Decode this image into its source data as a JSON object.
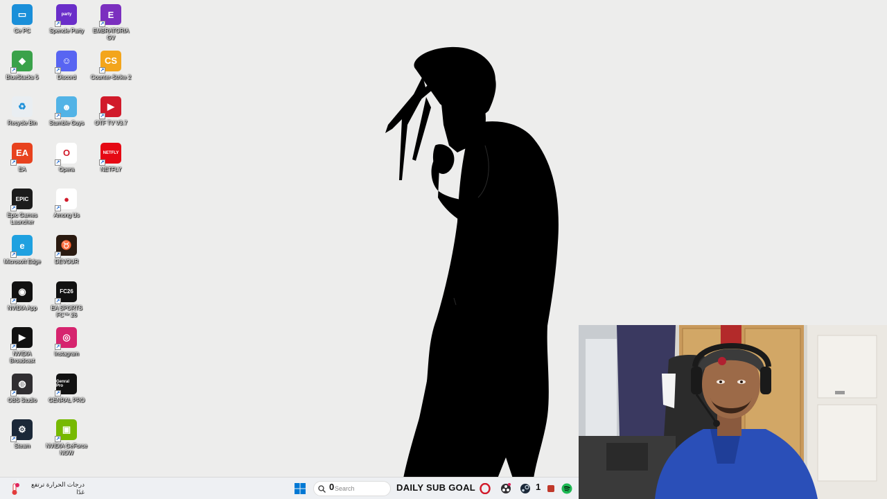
{
  "desktop": {
    "icons": [
      {
        "label": "Ce PC",
        "icon": "computer-icon",
        "color": "#1a8fd9",
        "glyph": "▭"
      },
      {
        "label": "Spencle Party",
        "icon": "spencle-party-icon",
        "color": "#6a2ec9",
        "glyph": "party"
      },
      {
        "label": "EMBRATORIA GV",
        "icon": "embratoria-icon",
        "color": "#7b2fbf",
        "glyph": "E"
      },
      {
        "label": "BlueStacks 5",
        "icon": "bluestacks-icon",
        "color": "#3aa24a",
        "glyph": "◆"
      },
      {
        "label": "Discord",
        "icon": "discord-icon",
        "color": "#5865f2",
        "glyph": "☺"
      },
      {
        "label": "Counter-Strike 2",
        "icon": "counter-strike-icon",
        "color": "#f3a51c",
        "glyph": "CS"
      },
      {
        "label": "Recycle Bin",
        "icon": "recycle-bin-icon",
        "color": "#e9eef2",
        "glyph": "♻"
      },
      {
        "label": "Stumble Guys",
        "icon": "stumble-guys-icon",
        "color": "#52b3e6",
        "glyph": "☻"
      },
      {
        "label": "OTF TV V3.7",
        "icon": "otf-tv-icon",
        "color": "#d11a2a",
        "glyph": "▶"
      },
      {
        "label": "EA",
        "icon": "ea-icon",
        "color": "#e8421e",
        "glyph": "EA"
      },
      {
        "label": "Opera",
        "icon": "opera-icon",
        "color": "#ffffff",
        "glyph": "O"
      },
      {
        "label": "NETFLY",
        "icon": "netfly-icon",
        "color": "#e50914",
        "glyph": "NETFLY"
      },
      {
        "label": "Epic Games Launcher",
        "icon": "epic-games-icon",
        "color": "#1c1c1c",
        "glyph": "EPIC"
      },
      {
        "label": "Among Us",
        "icon": "among-us-icon",
        "color": "#ffffff",
        "glyph": "●"
      },
      {
        "label": "",
        "icon": "blank-slot",
        "color": "#ededec",
        "glyph": ""
      },
      {
        "label": "Microsoft Edge",
        "icon": "edge-icon",
        "color": "#1fa1e0",
        "glyph": "e"
      },
      {
        "label": "DEVOUR",
        "icon": "devour-icon",
        "color": "#2a1a10",
        "glyph": "♉"
      },
      {
        "label": "",
        "icon": "blank-slot",
        "color": "#ededec",
        "glyph": ""
      },
      {
        "label": "NVIDIA App",
        "icon": "nvidia-app-icon",
        "color": "#111111",
        "glyph": "◉"
      },
      {
        "label": "EA SPORTS FC™ 26",
        "icon": "ea-sports-fc-icon",
        "color": "#111111",
        "glyph": "FC26"
      },
      {
        "label": "",
        "icon": "blank-slot",
        "color": "#ededec",
        "glyph": ""
      },
      {
        "label": "NVIDIA Broadcast",
        "icon": "nvidia-broadcast-icon",
        "color": "#111111",
        "glyph": "▶"
      },
      {
        "label": "Instagram",
        "icon": "instagram-icon",
        "color": "#d6246e",
        "glyph": "◎"
      },
      {
        "label": "",
        "icon": "blank-slot",
        "color": "#ededec",
        "glyph": ""
      },
      {
        "label": "OBS Studio",
        "icon": "obs-studio-icon",
        "color": "#302e31",
        "glyph": "◍"
      },
      {
        "label": "GENRAL PRO",
        "icon": "genral-pro-icon",
        "color": "#111111",
        "glyph": "Genral Pro"
      },
      {
        "label": "",
        "icon": "blank-slot",
        "color": "#ededec",
        "glyph": ""
      },
      {
        "label": "Steam",
        "icon": "steam-icon",
        "color": "#1b2838",
        "glyph": "⚙"
      },
      {
        "label": "NVIDIA GeForce NOW",
        "icon": "geforce-now-icon",
        "color": "#76b900",
        "glyph": "▣"
      }
    ]
  },
  "taskbar": {
    "weather": {
      "line1": "درجات الحرارة ترتفع",
      "line2": "غدًا",
      "badge": "2"
    },
    "search": {
      "placeholder": "Search"
    },
    "overlay": {
      "sub_count": "0",
      "goal_label": "DAILY SUB GOAL",
      "target": "1"
    }
  },
  "colors": {
    "desktop_bg": "#ededec",
    "taskbar_bg": "#eef0f3",
    "windows_blue": "#0078d4",
    "spotify_green": "#1db954"
  }
}
